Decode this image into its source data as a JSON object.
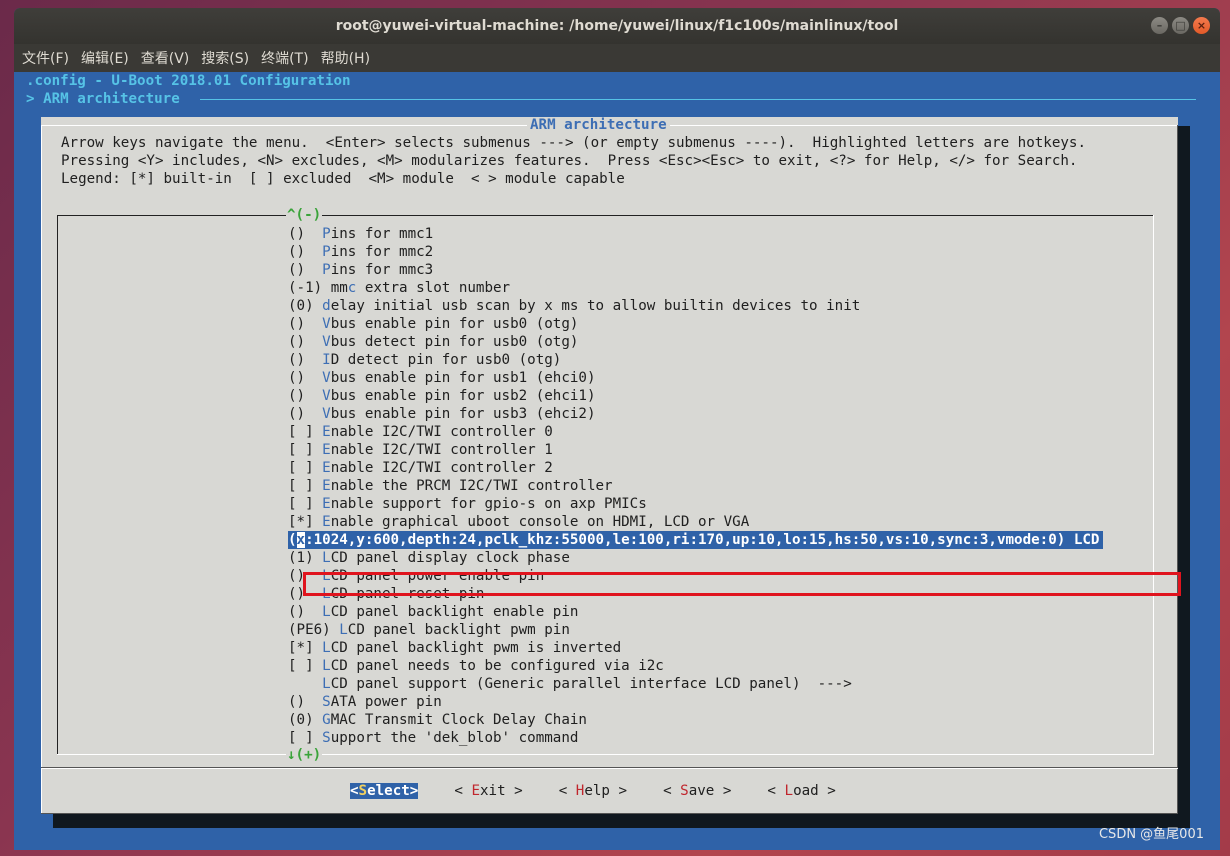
{
  "window": {
    "title": "root@yuwei-virtual-machine: /home/yuwei/linux/f1c100s/mainlinux/tool",
    "controls": {
      "minimize": "–",
      "maximize": "□",
      "close": "×"
    }
  },
  "menu": [
    "文件(F)",
    "编辑(E)",
    "查看(V)",
    "搜索(S)",
    "终端(T)",
    "帮助(H)"
  ],
  "header": {
    "config": ".config - U-Boot 2018.01 Configuration",
    "breadcrumb": "> ARM architecture"
  },
  "dialog": {
    "title": "ARM architecture",
    "help": [
      "Arrow keys navigate the menu.  <Enter> selects submenus ---> (or empty submenus ----).  Highlighted letters are hotkeys.",
      "Pressing <Y> includes, <N> excludes, <M> modularizes features.  Press <Esc><Esc> to exit, <?> for Help, </> for Search.",
      "Legend: [*] built-in  [ ] excluded  <M> module  < > module capable"
    ],
    "scroll_up": "^(-)",
    "scroll_down": "↓(+)",
    "items": [
      {
        "prefix": "()  ",
        "hotkey": "P",
        "rest": "ins for mmc1"
      },
      {
        "prefix": "()  ",
        "hotkey": "P",
        "rest": "ins for mmc2"
      },
      {
        "prefix": "()  ",
        "hotkey": "P",
        "rest": "ins for mmc3"
      },
      {
        "prefix": "(-1) mm",
        "hotkey": "c",
        "rest": " extra slot number"
      },
      {
        "prefix": "(0) ",
        "hotkey": "d",
        "rest": "elay initial usb scan by x ms to allow builtin devices to init"
      },
      {
        "prefix": "()  ",
        "hotkey": "V",
        "rest": "bus enable pin for usb0 (otg)"
      },
      {
        "prefix": "()  ",
        "hotkey": "V",
        "rest": "bus detect pin for usb0 (otg)"
      },
      {
        "prefix": "()  ",
        "hotkey": "I",
        "rest": "D detect pin for usb0 (otg)"
      },
      {
        "prefix": "()  ",
        "hotkey": "V",
        "rest": "bus enable pin for usb1 (ehci0)"
      },
      {
        "prefix": "()  ",
        "hotkey": "V",
        "rest": "bus enable pin for usb2 (ehci1)"
      },
      {
        "prefix": "()  ",
        "hotkey": "V",
        "rest": "bus enable pin for usb3 (ehci2)"
      },
      {
        "prefix": "[ ] ",
        "hotkey": "E",
        "rest": "nable I2C/TWI controller 0"
      },
      {
        "prefix": "[ ] ",
        "hotkey": "E",
        "rest": "nable I2C/TWI controller 1"
      },
      {
        "prefix": "[ ] ",
        "hotkey": "E",
        "rest": "nable I2C/TWI controller 2"
      },
      {
        "prefix": "[ ] ",
        "hotkey": "E",
        "rest": "nable the PRCM I2C/TWI controller"
      },
      {
        "prefix": "[ ] ",
        "hotkey": "E",
        "rest": "nable support for gpio-s on axp PMICs"
      },
      {
        "prefix": "[*] ",
        "hotkey": "E",
        "rest": "nable graphical uboot console on HDMI, LCD or VGA"
      },
      {
        "prefix": "(",
        "hotkey": "x",
        "rest": ":1024,y:600,depth:24,pclk_khz:55000,le:100,ri:170,up:10,lo:15,hs:50,vs:10,sync:3,vmode:0) LCD",
        "selected": true
      },
      {
        "prefix": "(1) ",
        "hotkey": "L",
        "rest": "CD panel display clock phase"
      },
      {
        "prefix": "()  ",
        "hotkey": "L",
        "rest": "CD panel power enable pin"
      },
      {
        "prefix": "()  ",
        "hotkey": "L",
        "rest": "CD panel reset pin"
      },
      {
        "prefix": "()  ",
        "hotkey": "L",
        "rest": "CD panel backlight enable pin"
      },
      {
        "prefix": "(PE6) ",
        "hotkey": "L",
        "rest": "CD panel backlight pwm pin"
      },
      {
        "prefix": "[*] ",
        "hotkey": "L",
        "rest": "CD panel backlight pwm is inverted"
      },
      {
        "prefix": "[ ] ",
        "hotkey": "L",
        "rest": "CD panel needs to be configured via i2c"
      },
      {
        "prefix": "    ",
        "hotkey": "L",
        "rest": "CD panel support (Generic parallel interface LCD panel)  --->"
      },
      {
        "prefix": "()  ",
        "hotkey": "S",
        "rest": "ATA power pin"
      },
      {
        "prefix": "(0) ",
        "hotkey": "G",
        "rest": "MAC Transmit Clock Delay Chain"
      },
      {
        "prefix": "[ ] ",
        "hotkey": "S",
        "rest": "upport the 'dek_blob' command"
      }
    ],
    "buttons": [
      {
        "pre": "<",
        "hotkey": "S",
        "rest": "elect>",
        "active": true
      },
      {
        "pre": "< ",
        "hotkey": "E",
        "rest": "xit >",
        "active": false
      },
      {
        "pre": "< ",
        "hotkey": "H",
        "rest": "elp >",
        "active": false
      },
      {
        "pre": "< ",
        "hotkey": "S",
        "rest": "ave >",
        "active": false
      },
      {
        "pre": "< ",
        "hotkey": "L",
        "rest": "oad >",
        "active": false
      }
    ]
  },
  "watermark": "CSDN @鱼尾001",
  "colors": {
    "terminal_bg": "#2f62a8",
    "dialog_bg": "#d8d8d4",
    "hotkey": "#3d6eb4",
    "highlight_box": "#e0141e"
  }
}
